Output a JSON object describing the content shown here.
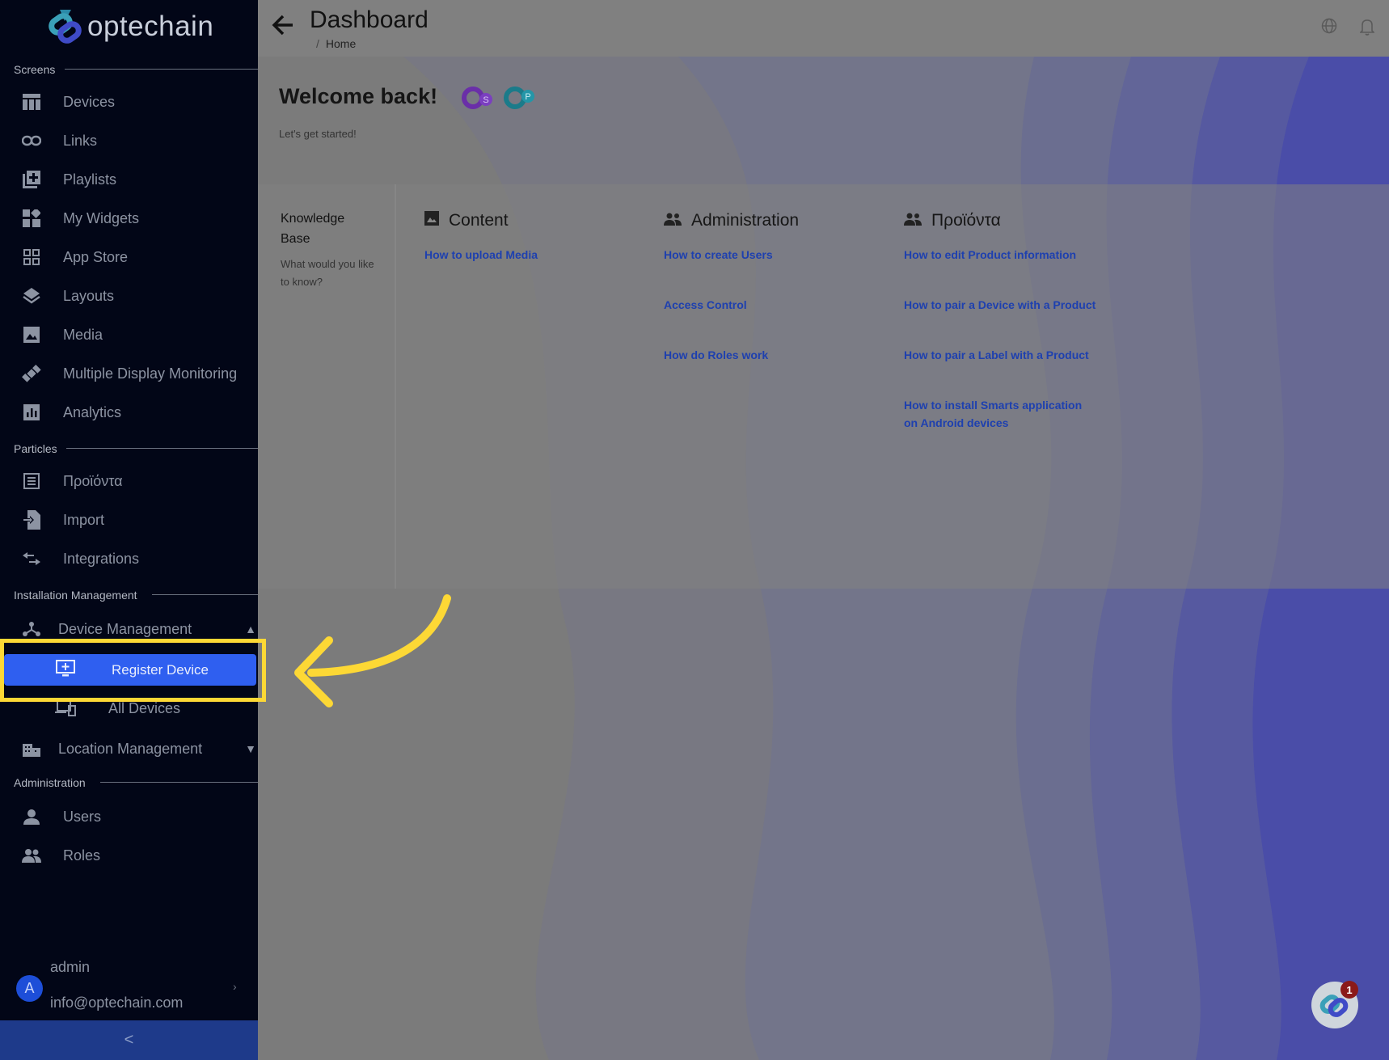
{
  "app": {
    "logo_text": "optechain"
  },
  "sidebar": {
    "sections": {
      "screens": "Screens",
      "particles": "Particles",
      "installation": "Installation Management",
      "administration": "Administration"
    },
    "items": {
      "devices": "Devices",
      "links": "Links",
      "playlists": "Playlists",
      "my_widgets": "My Widgets",
      "app_store": "App Store",
      "layouts": "Layouts",
      "media": "Media",
      "multi_display": "Multiple Display Monitoring",
      "analytics": "Analytics",
      "products": "Προϊόντα",
      "import": "Import",
      "integrations": "Integrations",
      "device_management": "Device Management",
      "register_device": "Register Device",
      "all_devices": "All Devices",
      "location_management": "Location Management",
      "users": "Users",
      "roles": "Roles"
    },
    "user": {
      "initial": "A",
      "name": "admin",
      "email": "info@optechain.com"
    },
    "collapse_label": "<"
  },
  "header": {
    "title": "Dashboard",
    "breadcrumb_sep": "/",
    "breadcrumb": "Home"
  },
  "main": {
    "welcome": "Welcome back!",
    "subtitle": "Let's get started!",
    "badge_1": "S",
    "badge_2": "P",
    "kb": {
      "title": "Knowledge Base",
      "subtitle": "What would you like to know?"
    },
    "columns": [
      {
        "title": "Content",
        "links": [
          "How to upload Media"
        ]
      },
      {
        "title": "Administration",
        "links": [
          "How to create Users",
          "Access Control",
          "How do Roles work"
        ]
      },
      {
        "title": "Προϊόντα",
        "links": [
          "How to edit Product information",
          "How to pair a Device with a Product",
          "How to pair a Label with a Product",
          "How to install Smarts application on Android devices"
        ]
      }
    ]
  },
  "help": {
    "badge_count": "1"
  },
  "colors": {
    "sidebar_bg": "#020617",
    "accent": "#2f5ff0",
    "highlight": "#fdd835",
    "link": "#1e40af"
  }
}
